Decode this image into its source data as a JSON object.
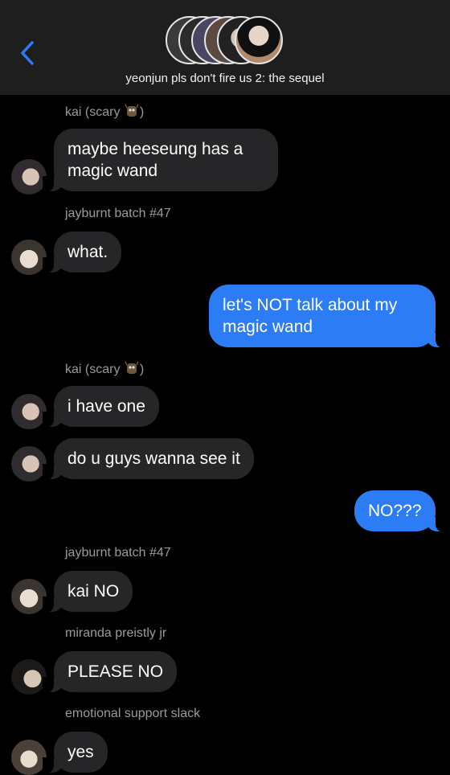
{
  "header": {
    "back_icon": "chevron-left-icon",
    "group_title": "yeonjun pls don't fire us 2: the sequel",
    "accent": "#2c7cf6",
    "group_avatars": [
      "avatar-1",
      "avatar-2",
      "avatar-3",
      "avatar-4",
      "avatar-5",
      "avatar-6"
    ]
  },
  "colors": {
    "incoming_bubble": "#262628",
    "outgoing_bubble": "#2c7cf6",
    "background": "#000000",
    "sender_label": "#9a9a9a"
  },
  "messages": [
    {
      "sender": "kai (scary",
      "sender_suffix": ")",
      "sender_emoji": "monster-emoji",
      "text": "maybe heeseung has a\nmagic wand",
      "direction": "in"
    },
    {
      "sender": "jayburnt batch #47",
      "text": "what.",
      "direction": "in"
    },
    {
      "text": "let's NOT talk about my\nmagic wand",
      "direction": "out"
    },
    {
      "sender": "kai (scary",
      "sender_suffix": ")",
      "sender_emoji": "monster-emoji",
      "text": "i have one",
      "direction": "in"
    },
    {
      "text": "do u guys wanna see it",
      "direction": "in"
    },
    {
      "text": "NO???",
      "direction": "out"
    },
    {
      "sender": "jayburnt batch #47",
      "text": "kai NO",
      "direction": "in"
    },
    {
      "sender": "miranda preistly jr",
      "text": "PLEASE NO",
      "direction": "in"
    },
    {
      "sender": "emotional support slack",
      "text": "yes",
      "direction": "in"
    }
  ]
}
